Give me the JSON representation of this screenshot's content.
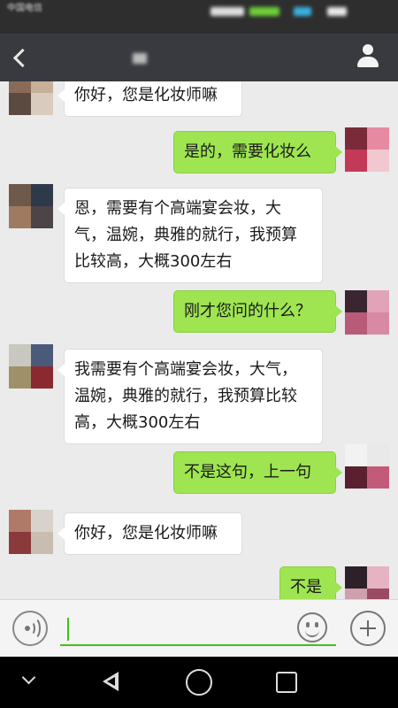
{
  "status_bar": {
    "carrier": "中国电信",
    "colors": {
      "background": "#2e2e2e"
    }
  },
  "title_bar": {
    "back_icon": "back-arrow-icon",
    "profile_icon": "person-icon",
    "colors": {
      "background": "#393a3f"
    }
  },
  "messages": [
    {
      "side": "in",
      "text": "你好，您是化妆师嘛"
    },
    {
      "side": "out",
      "text": "是的，需要化妆么"
    },
    {
      "side": "in",
      "text": "恩，需要有个高端宴会妆，大气，温婉，典雅的就行，我预算比较高，大概300左右"
    },
    {
      "side": "out",
      "text": "刚才您问的什么？"
    },
    {
      "side": "in",
      "text": "我需要有个高端宴会妆，大气，温婉，典雅的就行，我预算比较高，大概300左右"
    },
    {
      "side": "out",
      "text": "不是这句，上一句"
    },
    {
      "side": "in",
      "text": "你好，您是化妆师嘛"
    },
    {
      "side": "out",
      "text": "不是"
    }
  ],
  "input_bar": {
    "voice_icon": "voice-icon",
    "emoji_icon": "emoji-icon",
    "plus_icon": "plus-icon",
    "text_value": ""
  },
  "nav_bar": {
    "icons": [
      "chevron-down-icon",
      "back-triangle-icon",
      "home-circle-icon",
      "recent-square-icon"
    ]
  },
  "colors": {
    "chat_background": "#ebebeb",
    "incoming_bubble": "#ffffff",
    "outgoing_bubble": "#9ee551",
    "accent_green": "#45c01a"
  }
}
